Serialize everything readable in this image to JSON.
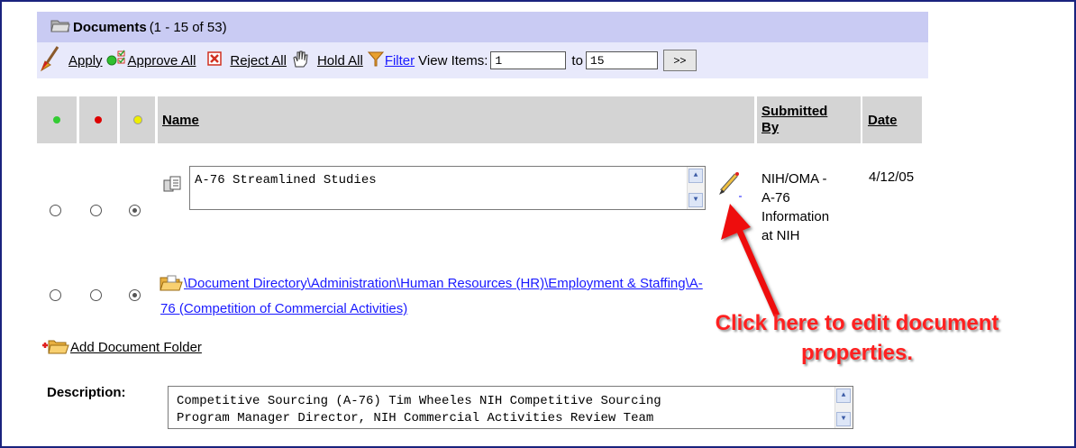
{
  "header": {
    "title": "Documents",
    "range": "(1 - 15 of 53)"
  },
  "toolbar": {
    "apply_label": "Apply",
    "approve_all_label": "Approve All",
    "reject_all_label": "Reject All",
    "hold_all_label": "Hold All",
    "filter_label": "Filter",
    "view_items_label": "View Items:",
    "from_value": "1",
    "to_label": "to",
    "to_value": "15",
    "next_label": ">>"
  },
  "table": {
    "columns": {
      "name": "Name",
      "submitted_by_line1": "Submitted",
      "submitted_by_line2": "By",
      "date": "Date"
    },
    "rows": [
      {
        "name": "A-76 Streamlined Studies",
        "submitted_by": [
          "NIH/OMA -",
          "A-76",
          "Information",
          "at NIH"
        ],
        "date": "4/12/05",
        "selected": "hold"
      },
      {
        "path_line1": "\\Document Directory\\Administration\\Human Resources (HR)\\Employment & Staffing\\A-",
        "path_line2": "76 (Competition of Commercial Activities)",
        "selected": "hold"
      }
    ]
  },
  "add_folder_label": "Add Document Folder",
  "description": {
    "label": "Description:",
    "line1": "Competitive Sourcing (A-76) Tim Wheeles NIH Competitive Sourcing",
    "line2": "Program Manager Director, NIH Commercial Activities Review Team"
  },
  "callout": {
    "line1": "Click here to edit document",
    "line2": "properties."
  },
  "colors": {
    "title_bg": "#c9cbf3",
    "toolbar_bg": "#e8e9fb",
    "header_bg": "#d4d4d4",
    "callout": "#ff2020",
    "frame": "#1a237e"
  }
}
